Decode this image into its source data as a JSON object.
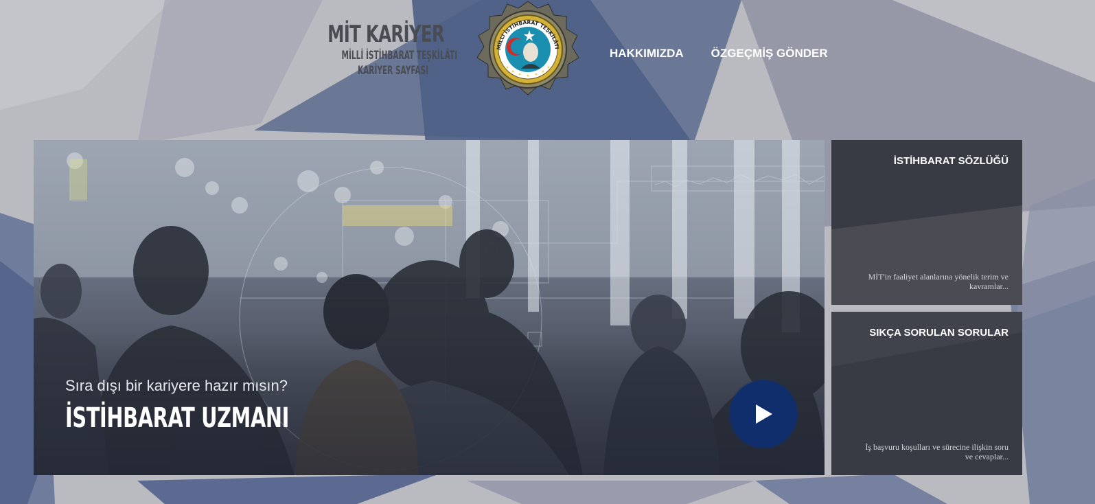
{
  "brand": {
    "title": "MİT KARİYER",
    "line1": "MİLLİ İSTİHBARAT TEŞKİLÂTI",
    "line2": "KARİYER SAYFASI"
  },
  "emblem": {
    "ring_text": "MİLLİ İSTİHBARAT TEŞKİLÂTI"
  },
  "nav": {
    "items": [
      {
        "label": "HAKKIMIZDA"
      },
      {
        "label": "ÖZGEÇMİŞ GÖNDER"
      }
    ]
  },
  "hero": {
    "question": "Sıra dışı bir kariyere hazır mısın?",
    "title": "İSTİHBARAT UZMANI",
    "play_icon": "play-icon"
  },
  "cards": [
    {
      "title": "İSTİHBARAT SÖZLÜĞÜ",
      "description": "MİT'in faaliyet alanlarına yönelik terim ve kavramlar..."
    },
    {
      "title": "SIKÇA SORULAN SORULAR",
      "description": "İş başvuru koşulları ve sürecine ilişkin soru ve cevaplar..."
    }
  ],
  "colors": {
    "background": "#b9bbc1",
    "play_button": "#0f2e6b",
    "card": "#383a44",
    "brand_text": "#4a4c53"
  }
}
